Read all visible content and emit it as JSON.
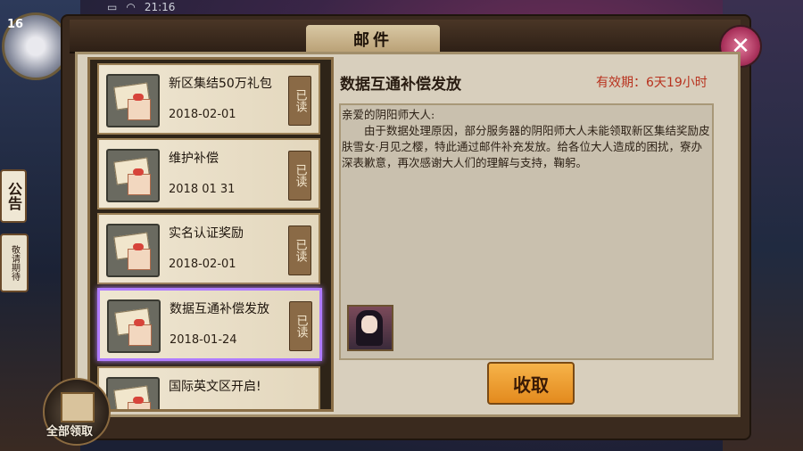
{
  "status_bar": {
    "time": "21:16"
  },
  "player": {
    "level": "16"
  },
  "side": {
    "notice_label": "公告",
    "notice2_label": "敬请期待"
  },
  "window": {
    "title": "邮件",
    "close_icon": "close-x-icon"
  },
  "mail_list": [
    {
      "title": "新区集结50万礼包",
      "date": "2018-02-01",
      "status": "已读"
    },
    {
      "title": "维护补偿",
      "date": "2018 01 31",
      "status": "已读"
    },
    {
      "title": "实名认证奖励",
      "date": "2018-02-01",
      "status": "已读"
    },
    {
      "title": "数据互通补偿发放",
      "date": "2018-01-24",
      "status": "已读"
    },
    {
      "title": "国际英文区开启!",
      "date": "",
      "status": ""
    }
  ],
  "selected_index": 3,
  "detail": {
    "title": "数据互通补偿发放",
    "expire": "有效期：6天19小时",
    "greeting": "亲爱的阴阳师大人:",
    "body": "由于数据处理原因，部分服务器的阴阳师大人未能领取新区集结奖励皮肤雪女·月见之樱，特此通过邮件补充发放。给各位大人造成的困扰，寮办深表歉意，再次感谢大人们的理解与支持，鞠躬。",
    "reward_icon": "character-skin-icon",
    "collect_label": "收取"
  },
  "footer": {
    "collect_all_label": "全部领取",
    "collect_all_icon": "gift-box-icon"
  },
  "colors": {
    "accent": "#e38a1e",
    "expire": "#b8321e",
    "selected_border": "#b07cff"
  }
}
